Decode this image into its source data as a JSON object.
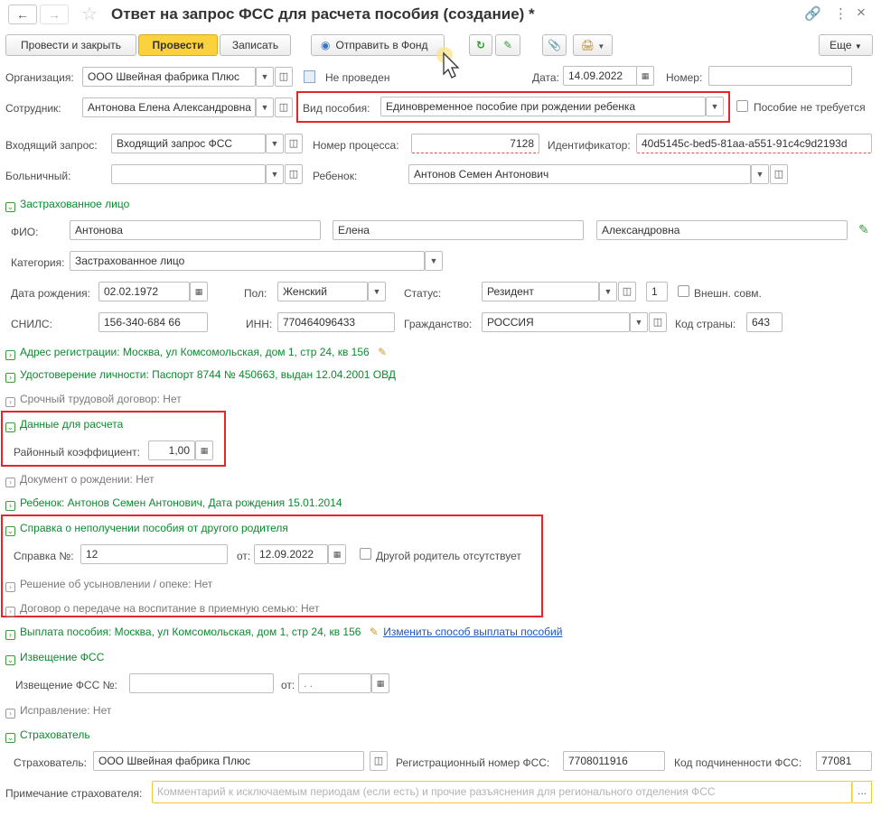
{
  "title": "Ответ на запрос ФСС для расчета пособия (создание) *",
  "toolbar": {
    "post_close": "Провести и закрыть",
    "post": "Провести",
    "save": "Записать",
    "send_to_fund": "Отправить в Фонд",
    "more": "Еще"
  },
  "header": {
    "org_label": "Организация:",
    "org_value": "ООО Швейная фабрика Плюс",
    "status_text": "Не проведен",
    "date_label": "Дата:",
    "date_value": "14.09.2022",
    "number_label": "Номер:",
    "number_value": "",
    "employee_label": "Сотрудник:",
    "employee_value": "Антонова Елена Александровна",
    "benefit_type_label": "Вид пособия:",
    "benefit_type_value": "Единовременное пособие при рождении ребенка",
    "no_benefit_label": "Пособие не требуется",
    "incoming_label": "Входящий запрос:",
    "incoming_value": "Входящий запрос ФСС",
    "process_label": "Номер процесса:",
    "process_value": "7128",
    "id_label": "Идентификатор:",
    "id_value": "40d5145c-bed5-81aa-a551-91c4c9d2193d",
    "sick_label": "Больничный:",
    "sick_value": "",
    "child_label": "Ребенок:",
    "child_value": "Антонов Семен Антонович"
  },
  "insured": {
    "section": "Застрахованное лицо",
    "fio_label": "ФИО:",
    "last_name": "Антонова",
    "first_name": "Елена",
    "middle_name": "Александровна",
    "category_label": "Категория:",
    "category_value": "Застрахованное лицо",
    "birth_label": "Дата рождения:",
    "birth_value": "02.02.1972",
    "sex_label": "Пол:",
    "sex_value": "Женский",
    "status_label": "Статус:",
    "status_value": "Резидент",
    "status_num": "1",
    "ext_label": "Внешн. совм.",
    "snils_label": "СНИЛС:",
    "snils_value": "156-340-684 66",
    "inn_label": "ИНН:",
    "inn_value": "770464096433",
    "citizen_label": "Гражданство:",
    "citizen_value": "РОССИЯ",
    "country_label": "Код страны:",
    "country_value": "643"
  },
  "sections": {
    "address": "Адрес регистрации: Москва, ул Комсомольская, дом 1, стр 24, кв 156",
    "identity": "Удостоверение личности: Паспорт 8744 № 450663, выдан 12.04.2001 ОВД",
    "contract": "Срочный трудовой договор: Нет",
    "calc": "Данные для расчета",
    "coef_label": "Районный коэффициент:",
    "coef_value": "1,00",
    "birth_doc": "Документ о рождении: Нет",
    "child": "Ребенок: Антонов Семен Антонович, Дата рождения 15.01.2014",
    "certificate": "Справка о неполучении пособия от другого родителя",
    "cert_no_label": "Справка №:",
    "cert_no_value": "12",
    "cert_from_label": "от:",
    "cert_date": "12.09.2022",
    "no_parent_label": "Другой родитель отсутствует",
    "adoption": "Решение об усыновлении / опеке: Нет",
    "foster": "Договор о передаче на воспитание в приемную семью: Нет",
    "payment": "Выплата пособия: Москва, ул Комсомольская, дом 1, стр 24, кв 156",
    "payment_link": "Изменить способ выплаты пособий",
    "notice": "Извещение ФСС",
    "notice_no_label": "Извещение ФСС №:",
    "notice_no_value": "",
    "notice_from_label": "от:",
    "notice_date": " .  .",
    "correction": "Исправление: Нет",
    "insurer": "Страхователь",
    "insurer_label": "Страхователь:",
    "insurer_value": "ООО Швейная фабрика Плюс",
    "reg_label": "Регистрационный номер ФСС:",
    "reg_value": "7708011916",
    "sub_label": "Код подчиненности ФСС:",
    "sub_value": "77081",
    "comment_label": "Примечание страхователя:",
    "comment_placeholder": "Комментарий к исключаемым периодам (если есть) и прочие разъяснения для регионального отделения ФСС"
  }
}
